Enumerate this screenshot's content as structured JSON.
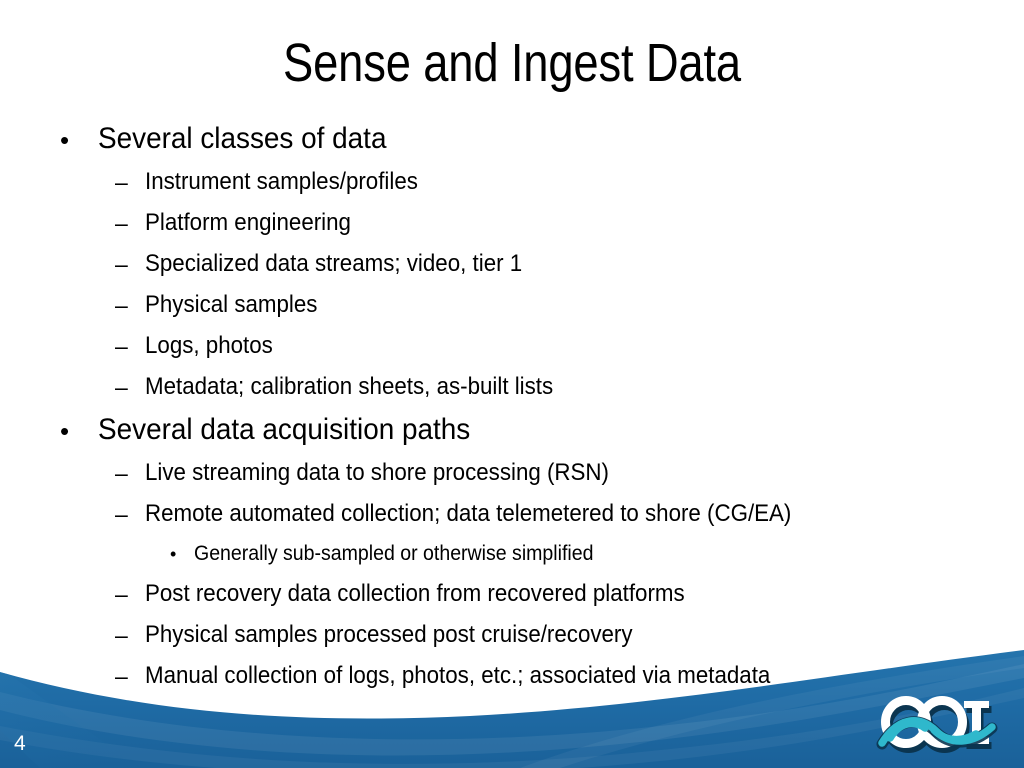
{
  "slide": {
    "title": "Sense and Ingest Data",
    "page_number": "4",
    "background_color": "#ffffff",
    "text_color": "#000000"
  },
  "footer": {
    "wave_color_dark": "#1b5f92",
    "wave_color_mid": "#1f6ba5",
    "wave_color_light": "#2c7cb5",
    "page_number": "4"
  },
  "logo": {
    "name": "OOI",
    "letters": "OOI",
    "letter_color": "#ffffff",
    "ribbon_color": "#2fb8cc",
    "outline_color": "#0b3550"
  },
  "bullets": [
    {
      "level": 1,
      "marker": "•",
      "text": "Several classes of data"
    },
    {
      "level": 2,
      "marker": "–",
      "text": "Instrument samples/profiles"
    },
    {
      "level": 2,
      "marker": "–",
      "text": "Platform engineering"
    },
    {
      "level": 2,
      "marker": "–",
      "text": "Specialized data streams; video, tier 1"
    },
    {
      "level": 2,
      "marker": "–",
      "text": "Physical samples"
    },
    {
      "level": 2,
      "marker": "–",
      "text": "Logs, photos"
    },
    {
      "level": 2,
      "marker": "–",
      "text": "Metadata; calibration sheets, as-built lists"
    },
    {
      "level": 1,
      "marker": "•",
      "text": "Several data acquisition paths"
    },
    {
      "level": 2,
      "marker": "–",
      "text": "Live streaming data to shore processing (RSN)"
    },
    {
      "level": 2,
      "marker": "–",
      "text": "Remote automated collection; data telemetered to shore (CG/EA)"
    },
    {
      "level": 3,
      "marker": "•",
      "text": "Generally sub-sampled or otherwise simplified"
    },
    {
      "level": 2,
      "marker": "–",
      "text": "Post recovery data collection from recovered platforms"
    },
    {
      "level": 2,
      "marker": "–",
      "text": "Physical samples processed post cruise/recovery"
    },
    {
      "level": 2,
      "marker": "–",
      "text": "Manual collection of logs, photos, etc.; associated via metadata"
    },
    {
      "level": 2,
      "marker": "–",
      "text": "",
      "occluded": true
    }
  ]
}
